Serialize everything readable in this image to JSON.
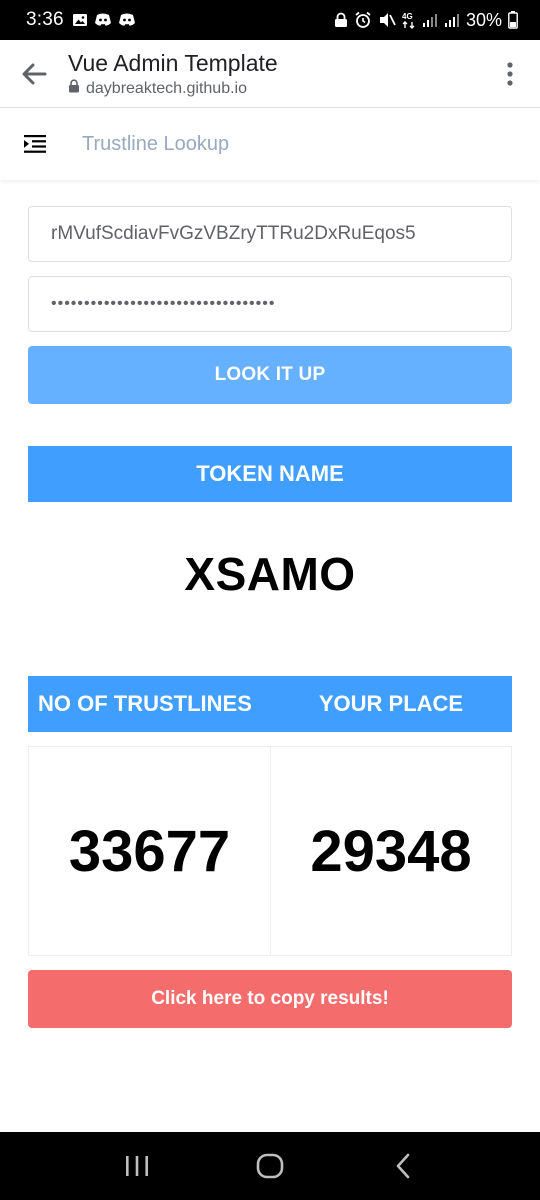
{
  "status_bar": {
    "time": "3:36",
    "battery_percent": "30%"
  },
  "browser": {
    "page_title": "Vue Admin Template",
    "url": "daybreaktech.github.io"
  },
  "app": {
    "title": "Trustline Lookup"
  },
  "form": {
    "address_value": "rMVufScdiavFvGzVBZryTTRu2DxRuEqos5",
    "secret_value": "••••••••••••••••••••••••••••••••••",
    "lookup_label": "LOOK IT UP"
  },
  "token": {
    "header": "TOKEN NAME",
    "name": "XSAMO"
  },
  "stats": {
    "trustlines_header": "NO OF TRUSTLINES",
    "place_header": "YOUR PLACE",
    "trustlines_value": "33677",
    "place_value": "29348"
  },
  "copy_label": "Click here to copy results!",
  "colors": {
    "primary": "#409eff",
    "primary_light": "#66b1ff",
    "danger": "#f56c6c",
    "muted_title": "#99a9bf"
  }
}
